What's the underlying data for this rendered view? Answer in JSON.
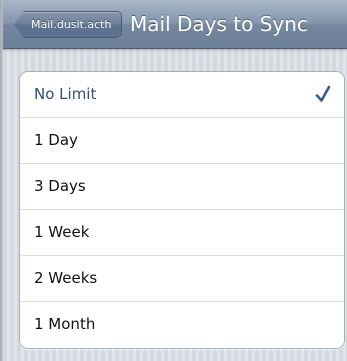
{
  "navbar": {
    "back_label": "Mail.dusit.acth",
    "title": "Mail Days to Sync"
  },
  "options": [
    {
      "label": "No Limit",
      "selected": true
    },
    {
      "label": "1 Day",
      "selected": false
    },
    {
      "label": "3 Days",
      "selected": false
    },
    {
      "label": "1 Week",
      "selected": false
    },
    {
      "label": "2 Weeks",
      "selected": false
    },
    {
      "label": "1 Month",
      "selected": false
    }
  ],
  "icons": {
    "selected_indicator": "checkmark-icon",
    "back_indicator": "back-arrow"
  },
  "colors": {
    "navbar": "#7d90a8",
    "selected_text": "#314d7d",
    "checkmark": "#3d5a8c",
    "background": "#d7dce3"
  }
}
